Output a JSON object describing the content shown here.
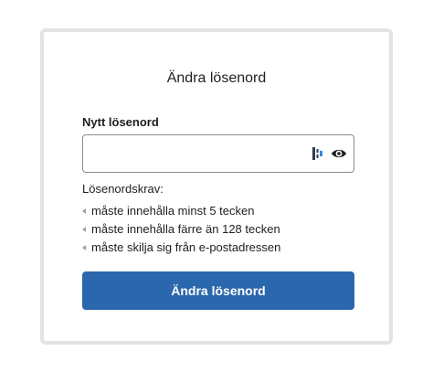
{
  "form": {
    "title": "Ändra lösenord",
    "field_label": "Nytt lösenord",
    "password_value": "",
    "password_placeholder": "",
    "requirements_heading": "Lösenordskrav:",
    "requirements": [
      "måste innehålla minst 5 tecken",
      "måste innehålla färre än 128 tecken",
      "måste skilja sig från e-postadressen"
    ],
    "submit_label": "Ändra lösenord"
  },
  "icons": {
    "password_manager": "password-manager-icon",
    "toggle_visibility": "eye-icon",
    "requirement_marker": "triangle-left-icon"
  },
  "colors": {
    "primary_button": "#2b67ad",
    "card_border": "#e3e3e3",
    "input_border": "#8c8c8c"
  }
}
